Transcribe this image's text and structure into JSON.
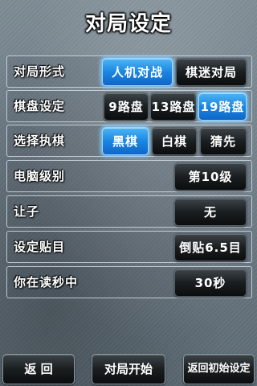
{
  "title": "对局设定",
  "rows": {
    "game_mode": {
      "label": "对局形式",
      "options": [
        "人机对战",
        "棋迷对局"
      ],
      "selected": "人机对战"
    },
    "board": {
      "label": "棋盘设定",
      "options": [
        "9路盘",
        "13路盘",
        "19路盘"
      ],
      "selected": "19路盘"
    },
    "color": {
      "label": "选择执棋",
      "options": [
        "黑棋",
        "白棋",
        "猜先"
      ],
      "selected": "黑棋"
    },
    "level": {
      "label": "电脑级别",
      "value": "第10级"
    },
    "handicap": {
      "label": "让子",
      "value": "无"
    },
    "komi": {
      "label": "设定贴目",
      "value": "倒贴6.5目"
    },
    "byoyomi": {
      "label": "你在读秒中",
      "value": "30秒"
    }
  },
  "bottom": {
    "back": "返 回",
    "start": "对局开始",
    "reset": "返回初始设定"
  },
  "colors": {
    "accent": "#1b86e0",
    "button_dark": "#1a1e20",
    "text": "#ffffff"
  }
}
